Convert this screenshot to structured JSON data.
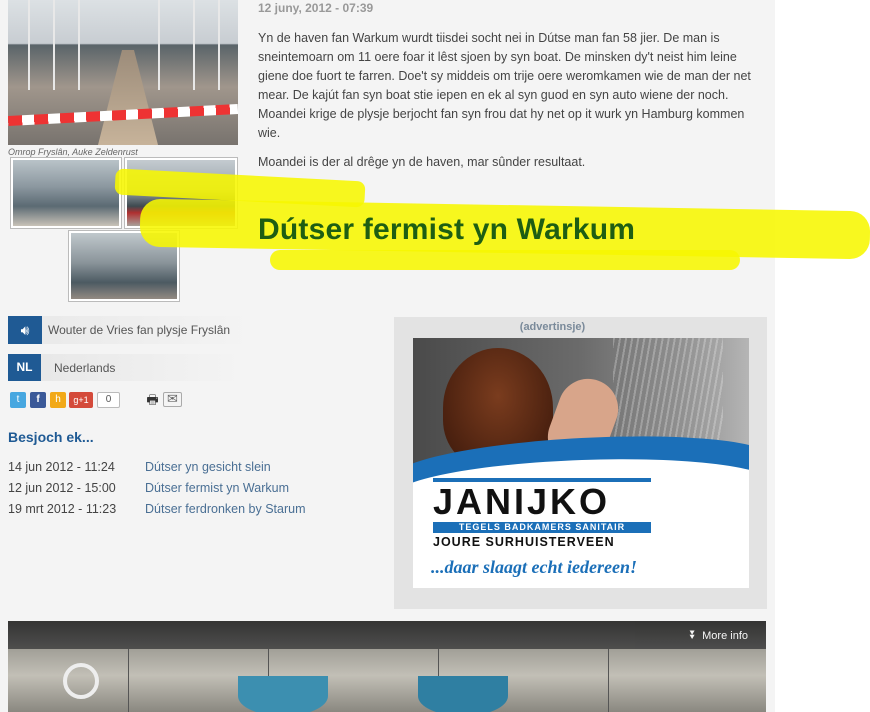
{
  "photo": {
    "caption": "Omrop Fryslân, Auke Zeldenrust"
  },
  "article": {
    "date": "12 juny, 2012 - 07:39",
    "paragraph1": "Yn de haven fan Warkum wurdt tiisdei socht nei in Dútse man fan 58 jier. De man is sneintemoarn om 11 oere foar it lêst sjoen by syn boat. De minsken dy't neist him leine giene doe fuort te farren. Doe't sy middeis om trije oere weromkamen wie de man der net mear. De kajút fan syn boat stie iepen en ek al syn guod en syn auto wiene der noch. Moandei krige de plysje berjocht fan syn frou dat hy net op it wurk yn Hamburg kommen wie.",
    "paragraph2": "Moandei is der al drêge yn de haven, mar sûnder resultaat.",
    "headline": "Dútser fermist yn Warkum"
  },
  "audio": {
    "label": "Wouter de Vries fan plysje Fryslân",
    "icon": "speaker-icon"
  },
  "language": {
    "badge": "NL",
    "label": "Nederlands"
  },
  "share": {
    "twitter": "t",
    "facebook": "f",
    "hyves": "h",
    "gplus": "g+1",
    "count": "0"
  },
  "related": {
    "title": "Besjoch ek...",
    "items": [
      {
        "date": "14 jun 2012 - 11:24",
        "title": "Dútser yn gesicht slein"
      },
      {
        "date": "12 jun 2012 - 15:00",
        "title": "Dútser fermist yn Warkum"
      },
      {
        "date": "19 mrt 2012 - 11:23",
        "title": "Dútser ferdronken by Starum"
      }
    ]
  },
  "ad": {
    "label": "(advertinsje)",
    "brand": "JANIJKO",
    "tagline": "TEGELS BADKAMERS SANITAIR",
    "towns": "JOURE SURHUISTERVEEN",
    "slogan": "...daar slaagt echt iedereen!"
  },
  "video": {
    "more_info": "More info"
  },
  "colors": {
    "accent_blue": "#1f5a94",
    "headline_green": "#1e5e13",
    "highlight_yellow": "#f7f700"
  }
}
